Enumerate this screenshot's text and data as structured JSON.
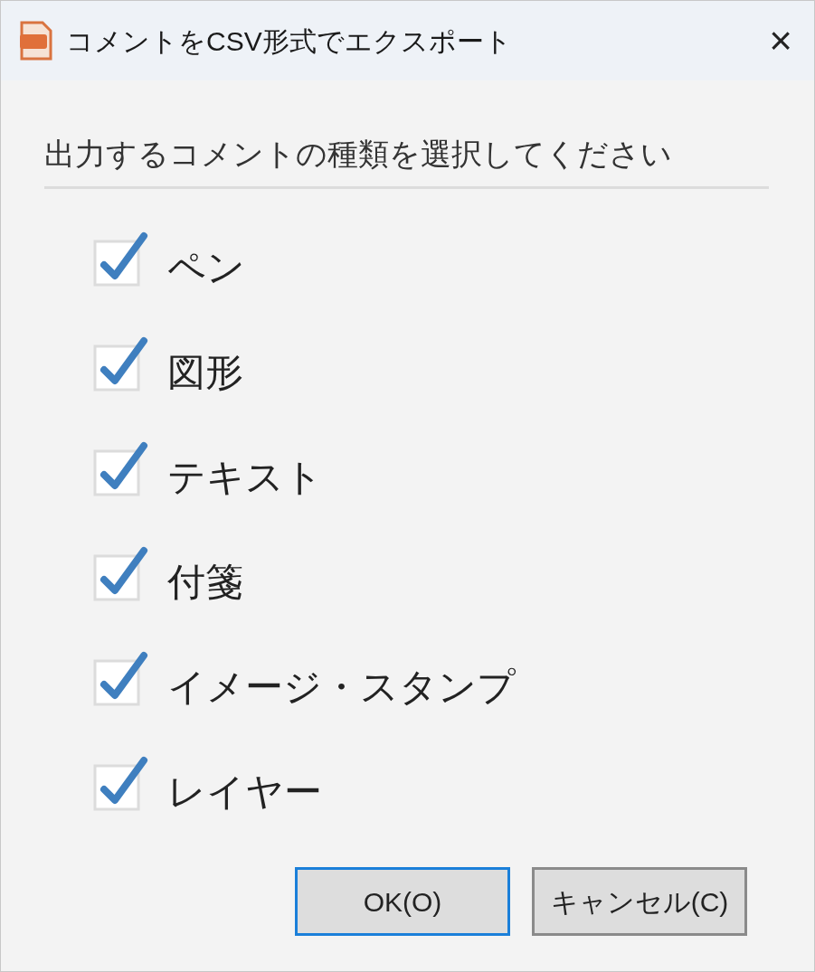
{
  "window": {
    "title": "コメントをCSV形式でエクスポート",
    "close": "×"
  },
  "heading": "出力するコメントの種類を選択してください",
  "options": [
    {
      "label": "ペン",
      "checked": true
    },
    {
      "label": "図形",
      "checked": true
    },
    {
      "label": "テキスト",
      "checked": true
    },
    {
      "label": "付箋",
      "checked": true
    },
    {
      "label": "イメージ・スタンプ",
      "checked": true
    },
    {
      "label": "レイヤー",
      "checked": true
    }
  ],
  "buttons": [
    {
      "label": "OK(O)",
      "selected": true
    },
    {
      "label": "キャンセル(C)",
      "selected": false
    }
  ]
}
